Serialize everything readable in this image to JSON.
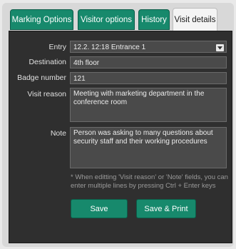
{
  "tabs": [
    {
      "label": "Marking Options"
    },
    {
      "label": "Visitor options"
    },
    {
      "label": "History"
    },
    {
      "label": "Visit details"
    }
  ],
  "form": {
    "entry_label": "Entry",
    "entry_value": "12.2.  12:18 Entrance 1",
    "destination_label": "Destination",
    "destination_value": "4th floor",
    "badge_label": "Badge number",
    "badge_value": "121",
    "visit_reason_label": "Visit reason",
    "visit_reason_value": "Meeting with marketing department in the conference room",
    "note_label": "Note",
    "note_value": "Person was asking to many questions about security staff and their working procedures"
  },
  "hint": "* When editting 'Visit reason' or 'Note' fields, you can enter multiple lines by pressing Ctrl + Enter keys",
  "buttons": {
    "save": "Save",
    "save_print": "Save & Print"
  },
  "colors": {
    "accent": "#17896c",
    "panel": "#2f2f2f",
    "field": "#4a4a4a"
  }
}
